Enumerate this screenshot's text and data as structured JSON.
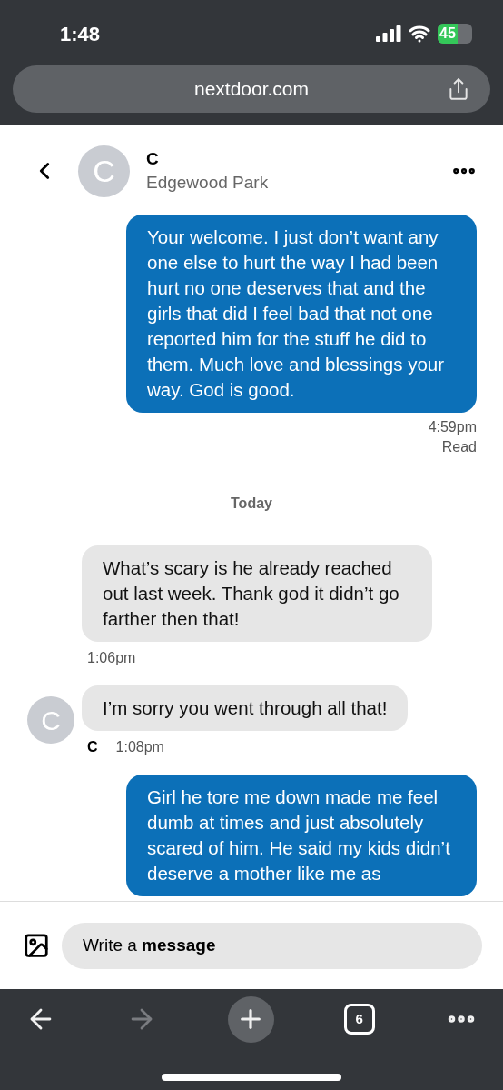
{
  "status_bar": {
    "time": "1:48",
    "battery": "45"
  },
  "address_bar": {
    "url": "nextdoor.com"
  },
  "header": {
    "avatar_letter": "C",
    "name": "C",
    "subtitle": "Edgewood Park"
  },
  "messages": [
    {
      "kind": "outgoing",
      "text": "Your welcome. I just don’t want any one else to hurt the way I had been hurt no one deserves that and the girls that did I feel bad that not one reported him for the stuff he did to them. Much love and blessings your way. God is good.",
      "time": "4:59pm",
      "status": "Read"
    },
    {
      "kind": "divider",
      "text": "Today"
    },
    {
      "kind": "incoming",
      "text": "What’s scary is he already reached out last week. Thank god it didn’t go farther then that!",
      "time": "1:06pm"
    },
    {
      "kind": "incoming",
      "text": "I’m sorry you went through all that!",
      "avatar_letter": "C",
      "sender": "C",
      "time": "1:08pm"
    },
    {
      "kind": "outgoing",
      "text": "Girl he tore me down made me feel dumb at times and just absolutely scared of him. He said my kids didn’t deserve a mother like me as"
    }
  ],
  "composer": {
    "placeholder": "Write a **message**"
  },
  "browser_toolbar": {
    "back_disabled": false,
    "forward_disabled": true,
    "tab_count": "6"
  }
}
